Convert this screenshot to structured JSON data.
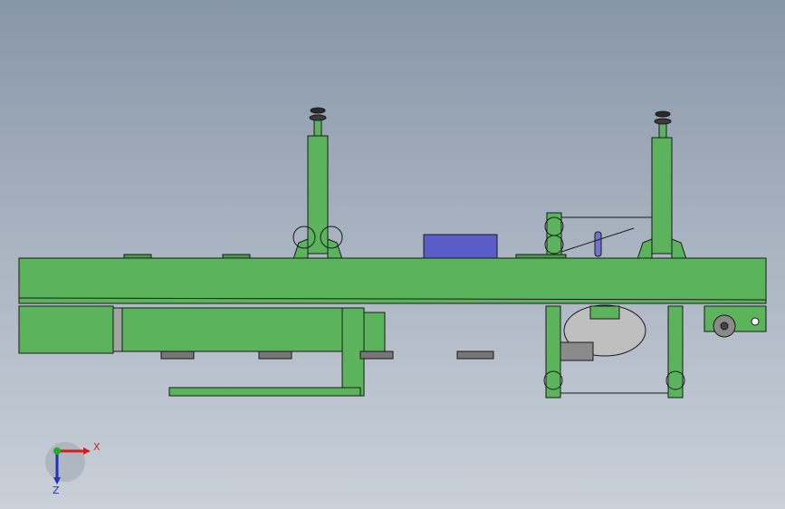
{
  "scene": {
    "background_top": "#8796a8",
    "background_bottom": "#c9d0d8",
    "machine_color": "#5bb45c",
    "outline_color": "#1a1a1a",
    "accent_box_color": "#5a5cc8",
    "accent_bar_color": "#6f74c9",
    "roll_color": "#bfbfbf"
  },
  "triad": {
    "x_label": "X",
    "z_label": "Z",
    "x_color": "#d02020",
    "z_color": "#2030c0",
    "origin_color": "#20b020"
  }
}
